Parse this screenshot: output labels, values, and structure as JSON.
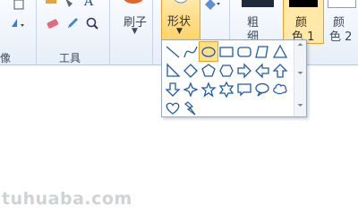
{
  "ribbon": {
    "image_group_label": "像",
    "tools_group_label": "工具",
    "brushes_label": "刷子",
    "shapes_label": "形状",
    "size_label": "粗",
    "size_label_line2": "细",
    "color1_label": "颜",
    "color1_label_line2": "色 1",
    "color2_label": "颜",
    "color2_label_line2": "色 2"
  },
  "shapes_gallery": {
    "selected": "oval",
    "items": [
      "line",
      "curve",
      "oval",
      "rectangle",
      "rounded-rectangle",
      "polygon",
      "triangle",
      "right-triangle",
      "diamond",
      "pentagon",
      "hexagon",
      "right-arrow",
      "left-arrow",
      "up-arrow",
      "down-arrow",
      "four-point-star",
      "five-point-star",
      "six-point-star",
      "rectangular-callout",
      "oval-callout",
      "cloud-callout",
      "heart",
      "lightning"
    ]
  },
  "colors": {
    "accent_orange": "#ffd15c",
    "color1": "#000000",
    "swatch_border": "#e2a52a"
  },
  "watermark": "tuhuaba.com"
}
